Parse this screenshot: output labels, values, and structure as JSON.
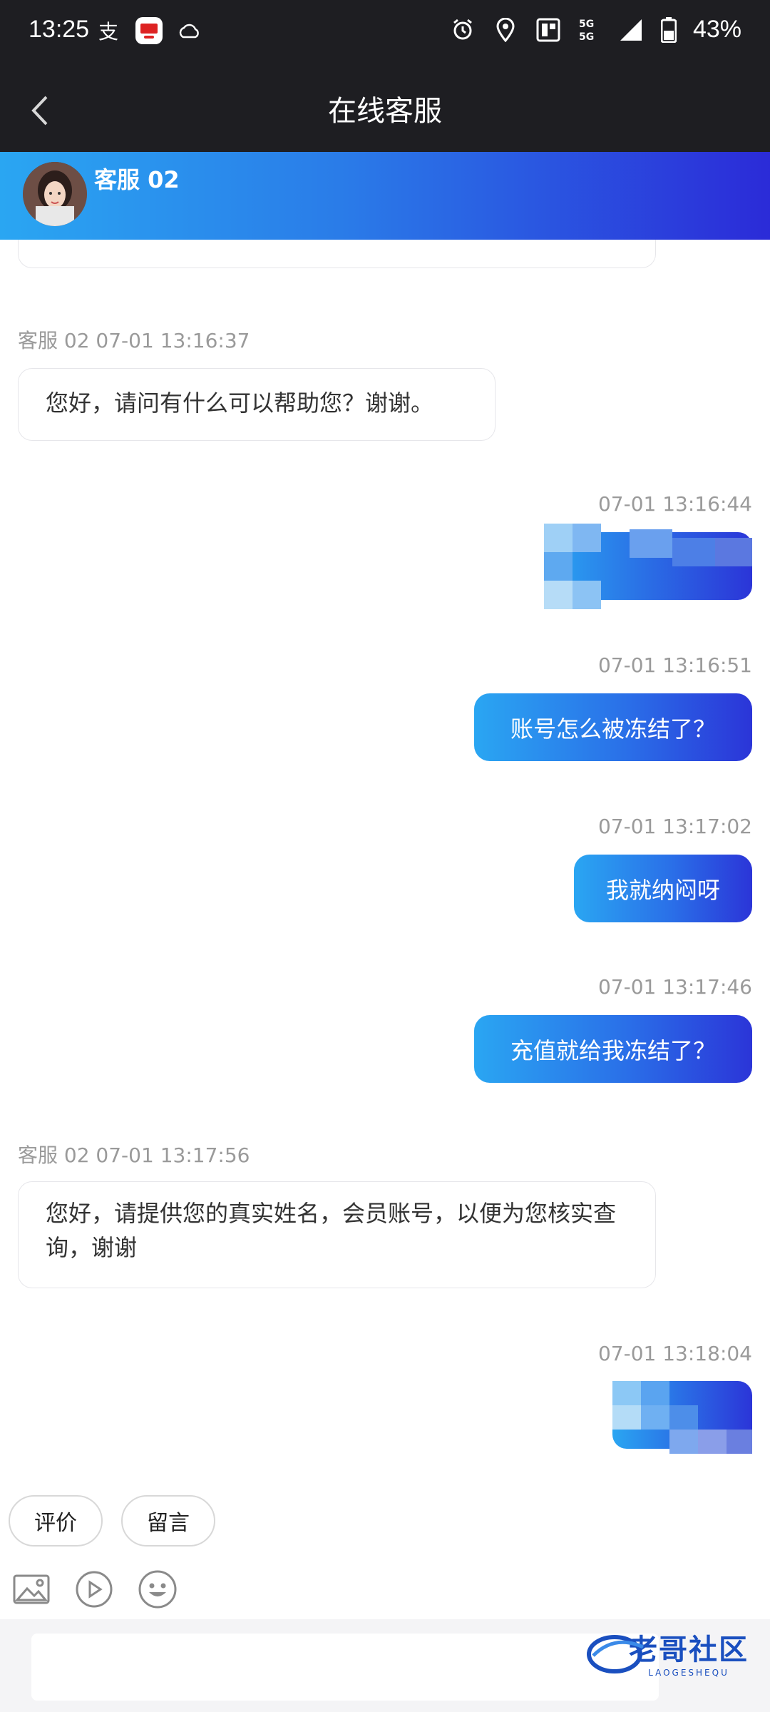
{
  "status_bar": {
    "time": "13:25",
    "battery": "43%",
    "network": "5G",
    "icons": [
      "alipay-icon",
      "app-badge-icon",
      "cloud-icon",
      "alarm-icon",
      "location-icon",
      "nfc-icon",
      "signal-icon",
      "battery-icon"
    ]
  },
  "nav": {
    "title": "在线客服",
    "back_icon": "chevron-left-icon"
  },
  "agent": {
    "name": "客服 02"
  },
  "messages": [
    {
      "side": "left",
      "meta": "客服 02 07-01 13:16:37",
      "text": "您好，请问有什么可以帮助您？谢谢。"
    },
    {
      "side": "right",
      "meta": "07-01 13:16:44",
      "text": "",
      "redacted": true
    },
    {
      "side": "right",
      "meta": "07-01 13:16:51",
      "text": "账号怎么被冻结了？"
    },
    {
      "side": "right",
      "meta": "07-01 13:17:02",
      "text": "我就纳闷呀"
    },
    {
      "side": "right",
      "meta": "07-01 13:17:46",
      "text": "充值就给我冻结了？"
    },
    {
      "side": "left",
      "meta": "客服 02 07-01 13:17:56",
      "text": "您好，请提供您的真实姓名，会员账号，以便为您核实查询，谢谢"
    },
    {
      "side": "right",
      "meta": "07-01 13:18:04",
      "text": "",
      "redacted": true
    }
  ],
  "actions": {
    "rate": "评价",
    "message": "留言"
  },
  "tools": [
    "image-icon",
    "video-icon",
    "emoji-icon"
  ],
  "input": {
    "placeholder": ""
  },
  "watermark": {
    "text": "老哥社区",
    "subtext": "LAOGESHEQU"
  },
  "colors": {
    "header_bg": "#1e1e22",
    "gradient_start": "#2aa6f2",
    "gradient_end": "#2b2bd8"
  }
}
